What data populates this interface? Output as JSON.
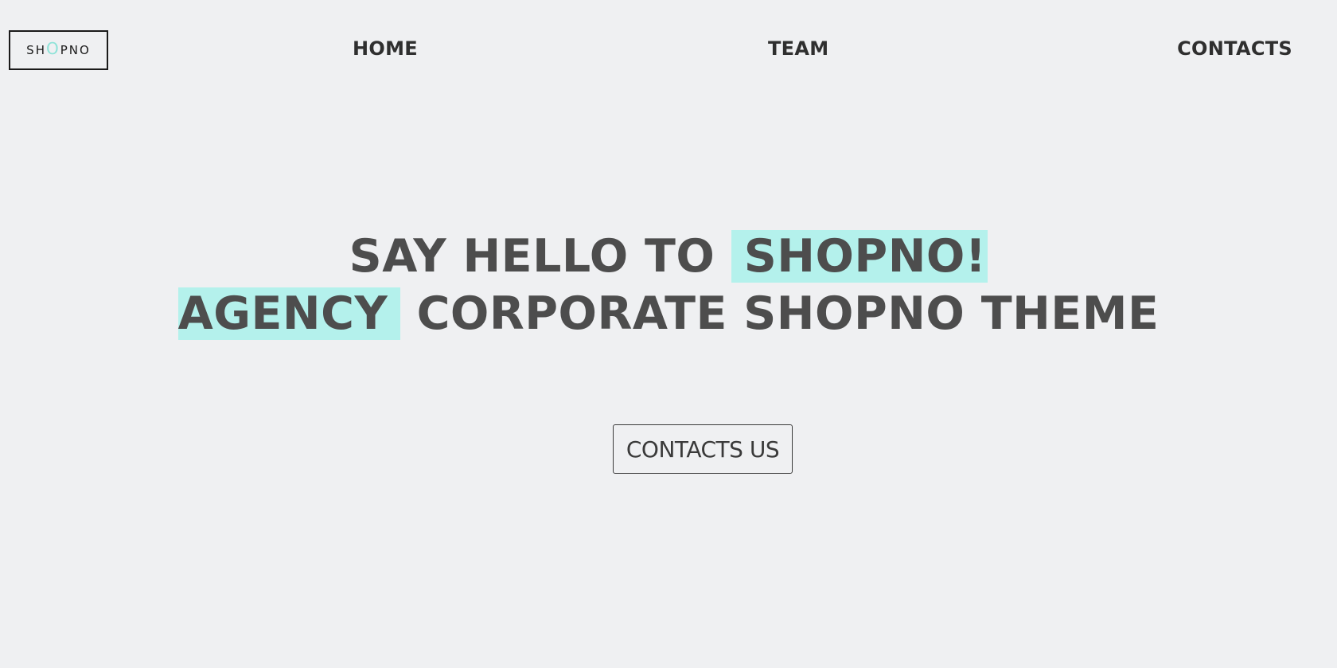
{
  "header": {
    "logo": {
      "before": "SH",
      "accent": "O",
      "after": "PNO"
    },
    "nav": [
      {
        "label": "HOME"
      },
      {
        "label": "TEAM"
      },
      {
        "label": "CONTACTS"
      }
    ]
  },
  "hero": {
    "line1": {
      "text": "SAY HELLO TO ",
      "highlight": "SHOPNO!"
    },
    "line2": {
      "highlight": "AGENCY",
      "text": " CORPORATE SHOPNO THEME"
    },
    "cta_label": "CONTACTS US"
  },
  "colors": {
    "background": "#eff0f2",
    "highlight": "#b4f1ec",
    "logo_accent": "#8ee3d8",
    "heading": "#4d4d4d",
    "nav_text": "#2f2f2f"
  }
}
